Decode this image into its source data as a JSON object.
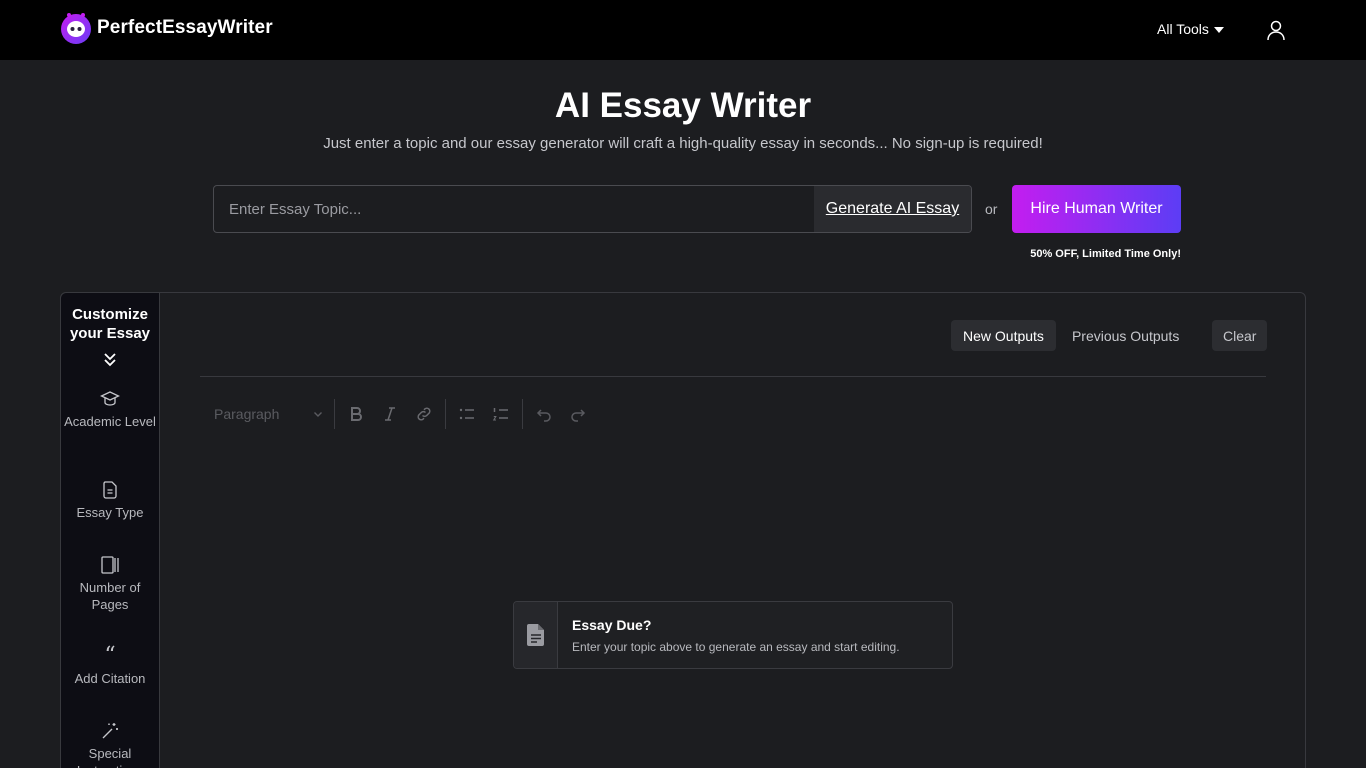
{
  "header": {
    "brand": "PerfectEssayWriter",
    "tools_label": "All Tools",
    "user_icon": "user-icon"
  },
  "hero": {
    "title": "AI Essay Writer",
    "subtitle": "Just enter a topic and our essay generator will craft a high-quality essay in seconds... No sign-up is required!",
    "topic_placeholder": "Enter Essay Topic...",
    "topic_value": "",
    "generate_label": "Generate AI Essay",
    "or_label": "or",
    "hire_label": "Hire Human Writer",
    "promo": "50% OFF, Limited Time Only!"
  },
  "sidebar": {
    "title": "Customize your Essay",
    "items": [
      {
        "label": "Academic Level",
        "icon": "graduation-cap-icon"
      },
      {
        "label": "Essay Type",
        "icon": "document-icon"
      },
      {
        "label": "Number of Pages",
        "icon": "pages-icon"
      },
      {
        "label": "Add Citation",
        "icon": "quote-icon"
      },
      {
        "label": "Special Instructions",
        "icon": "magic-wand-icon"
      }
    ]
  },
  "editor": {
    "tabs": [
      "New Outputs",
      "Previous Outputs"
    ],
    "active_tab": "New Outputs",
    "clear_label": "Clear",
    "block_format": "Paragraph",
    "toolbar_icons": [
      "bold-icon",
      "italic-icon",
      "link-icon",
      "bullet-list-icon",
      "numbered-list-icon",
      "undo-icon",
      "redo-icon"
    ]
  },
  "empty_state": {
    "title": "Essay Due?",
    "description": "Enter your topic above to generate an essay and start editing."
  },
  "colors": {
    "background": "#1c1d20",
    "header": "#000000",
    "accent_start": "#c41df0",
    "accent_end": "#5c3df5"
  }
}
